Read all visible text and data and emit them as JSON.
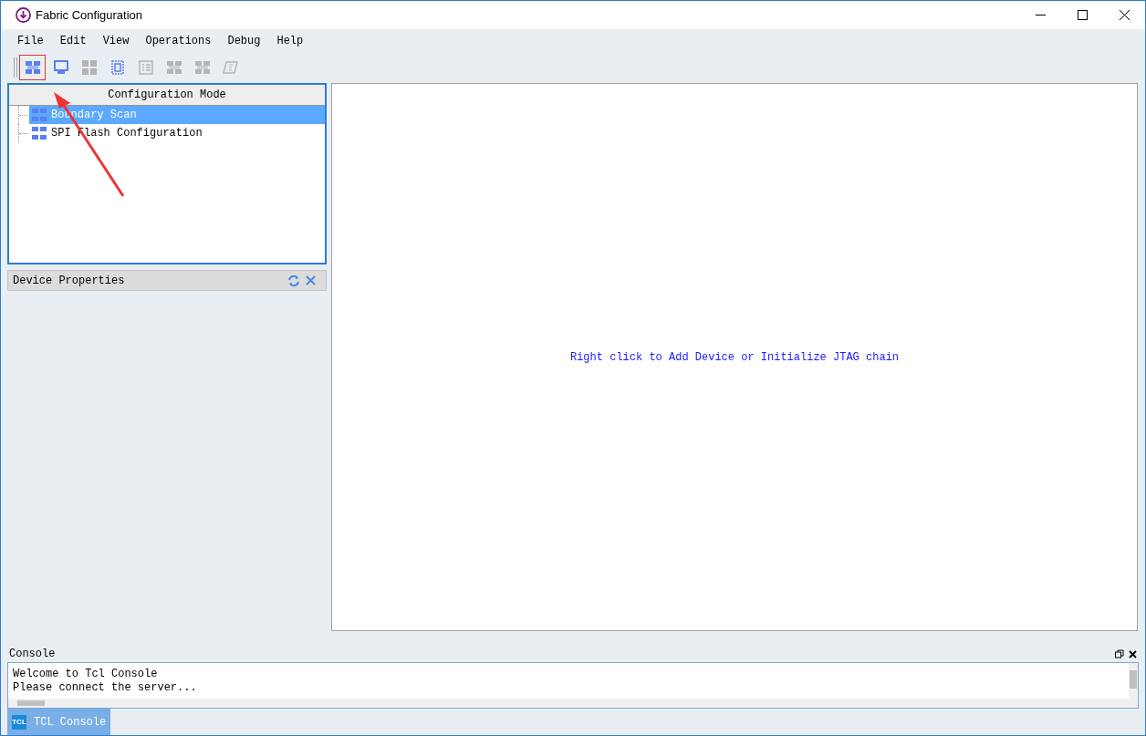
{
  "window": {
    "title": "Fabric Configuration"
  },
  "menu": [
    {
      "label": "File"
    },
    {
      "label": "Edit"
    },
    {
      "label": "View"
    },
    {
      "label": "Operations"
    },
    {
      "label": "Debug"
    },
    {
      "label": "Help"
    }
  ],
  "toolbar": [
    {
      "kind": "chain",
      "disabled": false,
      "selected": true
    },
    {
      "kind": "monitor",
      "disabled": false,
      "selected": false
    },
    {
      "kind": "grid",
      "disabled": true,
      "selected": false
    },
    {
      "kind": "chip",
      "disabled": false,
      "selected": false
    },
    {
      "kind": "list",
      "disabled": true,
      "selected": false
    },
    {
      "kind": "chain",
      "disabled": true,
      "selected": false
    },
    {
      "kind": "chain",
      "disabled": true,
      "selected": false
    },
    {
      "kind": "eraser",
      "disabled": true,
      "selected": false
    }
  ],
  "config_mode": {
    "header": "Configuration Mode",
    "items": [
      {
        "label": "Boundary Scan",
        "selected": true
      },
      {
        "label": "SPI Flash Configuration",
        "selected": false
      }
    ]
  },
  "device_properties": {
    "title": "Device Properties"
  },
  "canvas": {
    "hint": "Right click to Add Device or Initialize JTAG chain"
  },
  "console": {
    "title": "Console",
    "lines": [
      "Welcome to Tcl Console",
      "Please connect the server..."
    ],
    "tab": {
      "icon": "TCL",
      "label": "TCL Console",
      "selected": true
    }
  }
}
